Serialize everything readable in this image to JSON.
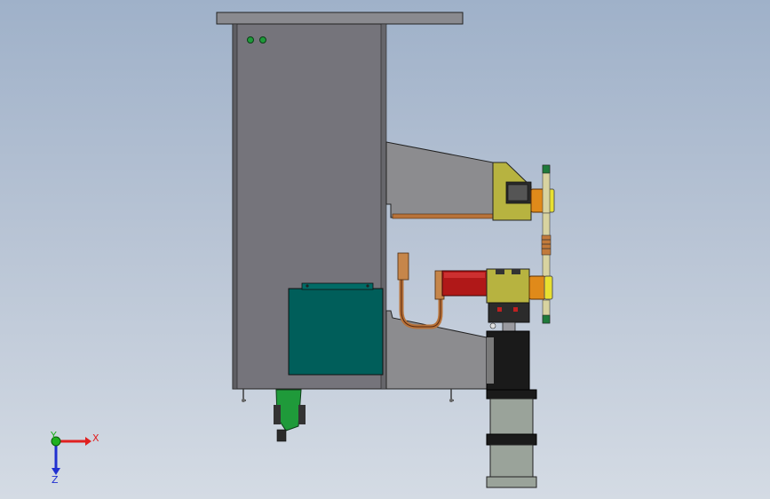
{
  "axis_triad": {
    "x_label": "X",
    "y_label": "Y",
    "z_label": "Z",
    "colors": {
      "x": "#e02020",
      "y": "#20b020",
      "z": "#2030d0"
    }
  },
  "colors": {
    "background_top": "#9fb1c9",
    "background_bottom": "#d4dbe4",
    "cabinet": "#75747b",
    "arm": "#8c8c8f",
    "control_box": "#005e5a",
    "electrode_holder": "#b7b340",
    "electrode_cap": "#e08a1a",
    "transformer_red": "#b01818",
    "cylinder": "#9aa39a"
  }
}
